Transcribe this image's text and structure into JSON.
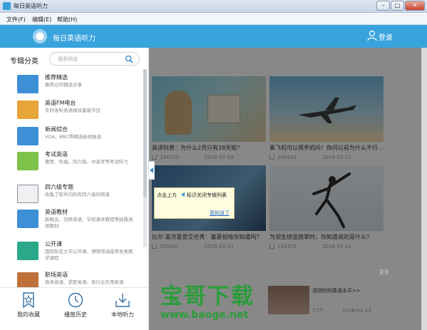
{
  "window": {
    "title": "每日英语听力"
  },
  "menu": [
    {
      "label": "文件(F)"
    },
    {
      "label": "编辑(E)"
    },
    {
      "label": "帮助(H)"
    }
  ],
  "header": {
    "app_name": "每日英语听力",
    "login_label": "登录",
    "color": "#39a3de"
  },
  "sidebar": {
    "heading": "专辑分类",
    "search_placeholder": "搜索频道",
    "categories": [
      {
        "title": "推荐精选",
        "desc": "推荐过的精选文章",
        "icon": "featured-icon",
        "color": "#3d8fd6"
      },
      {
        "title": "英语FM电台",
        "desc": "实时收听英语媒体最新节目",
        "icon": "radio-icon",
        "color": "#e8a53a"
      },
      {
        "title": "新闻综合",
        "desc": "VOA、BBC等精选新闻报道",
        "icon": "news-icon",
        "color": "#3d8fd6"
      },
      {
        "title": "考试英语",
        "desc": "雅思、托福、四六级、中高考等考试听力",
        "icon": "exam-icon",
        "color": "#7ec24a"
      },
      {
        "title": "四六级专题",
        "desc": "收集了软件内所有四六级的频道",
        "icon": "cet-icon",
        "color": "#8a8f96"
      },
      {
        "title": "英语教材",
        "desc": "新概念、剑桥英语、学校课本教程等经典英语教材",
        "icon": "textbook-icon",
        "color": "#3d8fd6"
      },
      {
        "title": "公开课",
        "desc": "国际知名大学公开课、博物馆讲座等各类教学课程",
        "icon": "graduation-cap-icon",
        "color": "#2aa889"
      },
      {
        "title": "职场英语",
        "desc": "商务英语、求职英语、各行业实用英语",
        "icon": "briefcase-icon",
        "color": "#c0703a"
      }
    ],
    "footer": [
      {
        "label": "我的收藏",
        "icon": "star-icon"
      },
      {
        "label": "播放历史",
        "icon": "clock-icon"
      },
      {
        "label": "本地听力",
        "icon": "download-icon"
      }
    ]
  },
  "main": {
    "cards": [
      {
        "caption": "英译科普：为什么2月只有28天呢？",
        "plays": "134103",
        "date": "2018-02-28"
      },
      {
        "caption": "乘飞机可以用手机吗！你问以前为什么不行...",
        "plays": "108433",
        "date": "2018-02-27"
      },
      {
        "caption": "比尔·盖茨喜登艾伦秀：富豪拍啥你知道吗？",
        "plays": "315007",
        "date": "2018-02-24"
      },
      {
        "caption": "为羽生结弦鼓掌时，你知道说的是什么？",
        "plays": "142375",
        "date": "2018-02-24"
      }
    ],
    "more_label": "更多",
    "list_item": {
      "title": "测测你的英语水平>>",
      "plays": "17万",
      "date": "2018-01-23"
    }
  },
  "tooltip": {
    "pre": "点击上方",
    "post": "标识关闭专辑列表",
    "ok_label": "我知道了"
  },
  "watermark": {
    "big": "宝哥下载",
    "small": "www.baoge.net"
  }
}
